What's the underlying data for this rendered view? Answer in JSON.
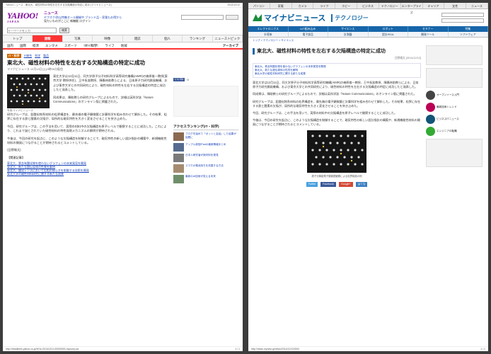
{
  "left": {
    "top_title": "Yahoo!ニュース - 東北大、磁性材料の特性を左右する欠陥構造の特定に成功 (マイナビニュース)",
    "top_date": "2014/12/12",
    "logo_main": "YAHOO!",
    "logo_sub": "JAPAN",
    "logo_tag": "ニュース",
    "header_line1": "ヤフオク!防災特集セール開催中 ブランド品・家電もお得から",
    "header_line2": "見たいものがここに 新機能 ログイン",
    "search_placeholder": "キーワードを入力",
    "search_button": "検索",
    "nav": [
      "トップ",
      "速報",
      "写真",
      "映像",
      "雑誌",
      "個人",
      "ランキング",
      "ニューストピック"
    ],
    "subnav": [
      "国内",
      "国際",
      "経済",
      "エンタメ",
      "スポーツ",
      "IT・科学",
      "ライフ",
      "地域"
    ],
    "subnav_active": "IT・科学",
    "archive": "アーカイブ",
    "tags": [
      "IT・科学",
      "IT総合",
      "科学",
      "製品"
    ],
    "headline": "東北大、磁性材料の特性を左右する欠陥構造の特定に成功",
    "meta": "マイナビニュース 12月13日(土)9時05分配信",
    "paragraphs": [
      "東北大学は12月11日、同大学原子分子材料科学高等研究機構(AIMR)の幾原雄一教授(東京大学 教授併任)、王中長准教授、陳春林助教らによる、日本原子力研究開発機構、および東京大学との共同研究により、磁性材料の特性を左右する欠陥構造の特定に成功したと発表した。",
      "同成果は、陳助教らの研究グループによるもので、詳細は英科学誌「Nature Communications」のオンライン版に掲載された。",
      "研究グループは、鉛酸化物系材料の粒界構造を、最先端の電子顕微鏡と計算科学を組み合わせて解析した。その結果、粒界に存在する鉄と酸素の欠陥が、局所的な磁気特性を大きく変化させることを突き止めた。",
      "今回、研究グループは、この手法を用いて、実際の材料中の欠陥構造を原子レベルで観察することに成功した。これにより、これまで謎とされていた磁性材料の特性発現メカニズムの解明が期待される。",
      "今後は、今回の研究を起点に、このような欠陥構造を制御することで、磁気特性の新しい設計指針の構築や、新規機能性材料の開発につながることが期待されるとコメントしている。",
      "(日野雄太)"
    ],
    "caption": "写真:マイナビニュース",
    "related_head": "【関連記事】",
    "related": [
      "東北大、鉄含有酸化物を使わないグラフェンの未来発見を開発",
      "東北大、新たな超伝導体の性質を解明",
      "東北大、酸化レンズにおいて位相の揺らぎを制御する技術を開発",
      "東北大学の磁性材料研究に関する新たな成果"
    ],
    "fb_label": "いいね!",
    "fb_count": "0",
    "ranking_head": "アクセスランキング(IT・科学)",
    "ranking": [
      "ブログを始めて「ボットと会話」した結果が話題に",
      "アップル新型iPadの最新情報まとめ",
      "日本人研究者が新材料を発見",
      "スマホの電池持ちを改善する方法",
      "最新のAI技術が変える未来"
    ],
    "footer_url": "http://headlines.yahoo.co.jp/hl?a=20141213-00000000-mycomj-sci",
    "footer_page": "1 / 1"
  },
  "right": {
    "topnav": [
      "パソコン",
      "家電",
      "カメラ",
      "ライフ",
      "ホビー",
      "ビジネス",
      "テクノロジー",
      "エンタープライズ",
      "キャリア",
      "女性",
      "ニュース"
    ],
    "logo_text": "マイナビニュース",
    "logo_section": "テクノロジー",
    "nav1": [
      "エレクトロニクス",
      "IoT/組み込み",
      "サイエンス",
      "ロボット",
      "セミナー",
      "特集"
    ],
    "nav2": [
      "半導体",
      "電子部品",
      "計測器",
      "設計/EDA",
      "開発ツール",
      "ソフトウェア"
    ],
    "breadcrumb": "トップ > テクノロジー > サイエンス",
    "title": "東北大、磁性材料の特性を左右する欠陥構造の特定に成功",
    "meta": "日野雄太 [2014/12/12]",
    "links": [
      "東北大、鉄含有酸化物を使わないグラフェンの未来発見を開発",
      "東北大、新たな超伝導体の性質を解明",
      "東北大学の磁性材料研究に関する新たな成果"
    ],
    "paragraphs": [
      "東北大学は12月11日、同大学原子分子材料科学高等研究機構(AIMR)の幾原雄一教授、王中長准教授、陳春林助教らによる、日本原子力研究開発機構、および東京大学との共同研究により、磁性材料の特性を左右する欠陥構造の特定に成功したと発表した。",
      "同成果は、陳助教らの研究グループによるもので、詳細は英科学誌「Nature Communications」のオンライン版に掲載された。",
      "研究グループは、鉛酸化物系材料の粒界構造を、最先端の電子顕微鏡と計算科学を組み合わせて解析した。その結果、粒界に存在する鉄と酸素の欠陥が、局所的な磁気特性を大きく変化させることを突き止めた。",
      "今回、研究グループは、この手法を用いて、実際の材料中の欠陥構造を原子レベルで観察することに成功した。",
      "今後は、今回の研究を起点に、このような欠陥構造を制御することで、磁気特性の新しい設計指針の構築や、新規機能性材料の開発につながることが期待されるとコメントしている。"
    ],
    "image_caption": "原子分解能電子顕微鏡観察による粒界構造の例",
    "share": [
      "Twitter",
      "Facebook",
      "Google+",
      "はてな"
    ],
    "share_colors": [
      "#4aa1e0",
      "#3b5998",
      "#d34836",
      "#3c7fc1"
    ],
    "side_items": [
      "オープンソース入門",
      "最新技術トレンド",
      "ビジネスITニュース",
      "エンジニアの転職"
    ],
    "footer_url": "http://news.mynavi.jp/news/2014/12/12/000/",
    "footer_page": "1 / 1"
  }
}
